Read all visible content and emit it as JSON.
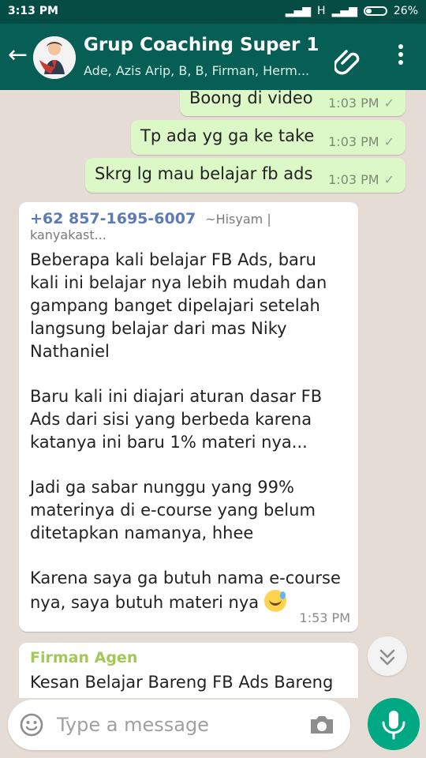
{
  "status": {
    "time": "3:13 PM",
    "network": "H",
    "battery": "26%"
  },
  "header": {
    "title": "Grup Coaching Super 1",
    "subtitle": "Ade, Azis Arip, B, B, Firman, Herm..."
  },
  "messages": {
    "outgoing": [
      {
        "text": "Boong di video",
        "time": "1:03 PM"
      },
      {
        "text": "Tp ada yg ga ke take",
        "time": "1:03 PM"
      },
      {
        "text": "Skrg lg mau belajar fb ads",
        "time": "1:03 PM"
      }
    ],
    "incoming_1": {
      "sender": "+62 857-1695-6007",
      "nick": "~Hisyam | kanyakast...",
      "p1": "Beberapa kali belajar FB Ads, baru kali ini belajar nya lebih mudah dan gampang banget dipelajari setelah langsung belajar dari mas Niky Nathaniel",
      "p2": "Baru kali ini diajari aturan dasar FB Ads dari sisi yang berbeda karena katanya ini baru 1% materi nya...",
      "p3": "Jadi ga sabar nunggu yang 99% materinya di e-course yang belum ditetapkan namanya, hhee",
      "p4": "Karena saya ga butuh nama e-course nya, saya butuh materi nya",
      "time": "1:53 PM"
    },
    "incoming_2": {
      "sender": "Firman Agen",
      "text": "Kesan Belajar Bareng FB Ads Bareng"
    }
  },
  "composer": {
    "placeholder": "Type a message"
  },
  "icons": {
    "back": "arrow-left-icon",
    "attach": "paperclip-icon",
    "menu": "more-vert-icon",
    "emoji": "smiley-icon",
    "camera": "camera-icon",
    "mic": "microphone-icon",
    "scroll": "double-chevron-down-icon"
  },
  "colors": {
    "appbar": "#075e54",
    "statusbar": "#054d44",
    "outgoing_bubble": "#dcf8c6",
    "incoming_bubble": "#ffffff",
    "mic_button": "#00a884"
  }
}
